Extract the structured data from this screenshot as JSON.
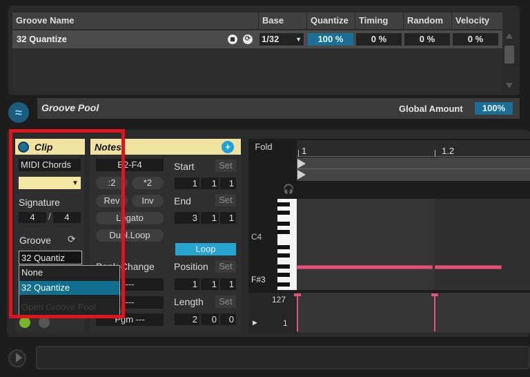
{
  "groove_pool": {
    "columns": [
      "Groove Name",
      "Base",
      "Quantize",
      "Timing",
      "Random",
      "Velocity"
    ],
    "row": {
      "name": "32 Quantize",
      "base": "1/32",
      "quantize": "100 %",
      "timing": "0 %",
      "random": "0 %",
      "velocity": "0 %"
    },
    "title": "Groove Pool",
    "global_amount_label": "Global Amount",
    "global_amount_value": "100%"
  },
  "clip": {
    "title": "Clip",
    "name": "MIDI Chords",
    "signature_label": "Signature",
    "signature_numerator": "4",
    "signature_separator": "/",
    "signature_denominator": "4",
    "groove_label": "Groove",
    "groove_value": "32 Quantiz",
    "dropdown_options": [
      "None",
      "32 Quantize",
      "Open Groove Pool"
    ]
  },
  "notes": {
    "title": "Notes",
    "range": "E2-F4",
    "div2": ":2",
    "mul2": "*2",
    "rev": "Rev",
    "inv": "Inv",
    "legato": "Legato",
    "dupl_loop": "Dupl.Loop",
    "bank_change": "Bank Change",
    "start_label": "Start",
    "end_label": "End",
    "position_label": "Position",
    "length_label": "Length",
    "set_label": "Set",
    "loop_label": "Loop",
    "start": [
      "1",
      "1",
      "1"
    ],
    "end": [
      "3",
      "1",
      "1"
    ],
    "position": [
      "1",
      "1",
      "1"
    ],
    "length": [
      "2",
      "0",
      "0"
    ],
    "field_a": "---",
    "field_b": "---",
    "field_c": "Pgm ---"
  },
  "piano_roll": {
    "fold_label": "Fold",
    "ruler_1": "1",
    "ruler_2": "1.2",
    "label_c4": "C4",
    "label_f3": "F#3",
    "vel_max": "127",
    "vel_min": "1"
  },
  "colors": {
    "accent_blue": "#1b6f97",
    "clip_header": "#f0e2a0",
    "note_pink": "#e0557a",
    "highlight_red": "#e0141b"
  }
}
